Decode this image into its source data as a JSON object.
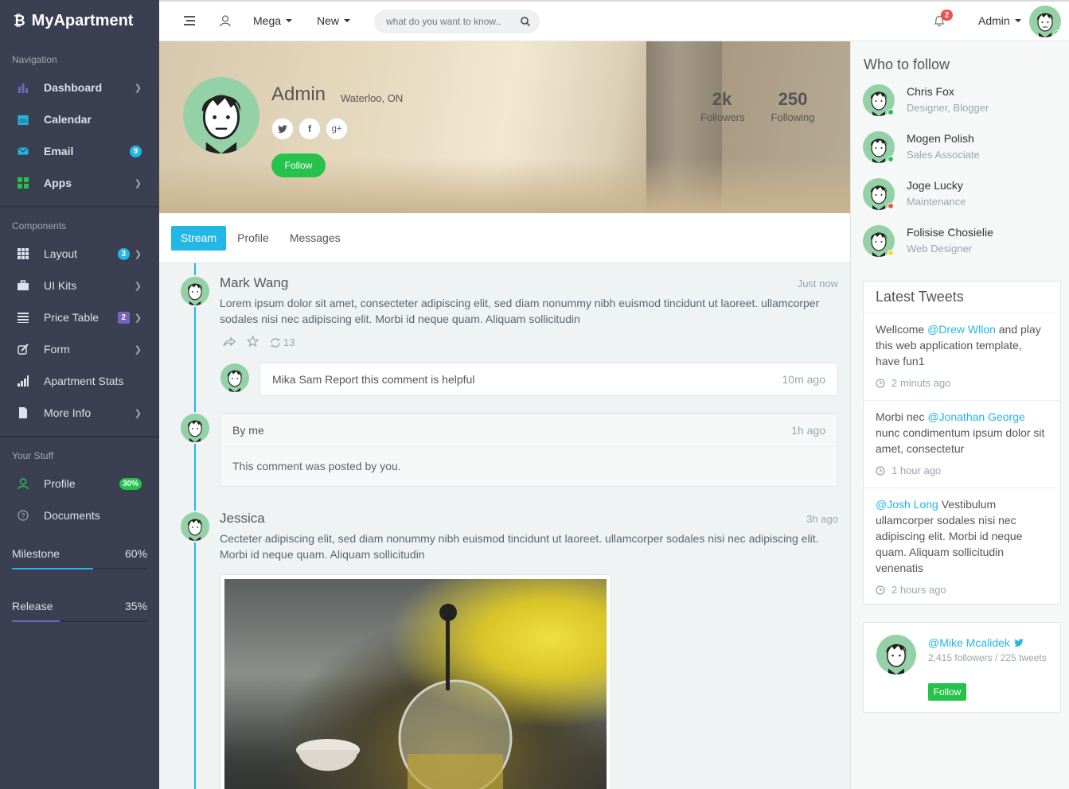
{
  "brand": {
    "name": "MyApartment"
  },
  "sidebar": {
    "sections": [
      "Navigation",
      "Components",
      "Your Stuff"
    ],
    "nav": [
      {
        "label": "Dashboard",
        "icon": "bar-chart-icon",
        "badge": ""
      },
      {
        "label": "Calendar",
        "icon": "calendar-icon",
        "badge": ""
      },
      {
        "label": "Email",
        "icon": "envelope-icon",
        "badge": "9"
      },
      {
        "label": "Apps",
        "icon": "grid-icon",
        "badge": ""
      }
    ],
    "components": [
      {
        "label": "Layout",
        "icon": "layout-icon",
        "badge": "3"
      },
      {
        "label": "UI Kits",
        "icon": "briefcase-icon",
        "badge": ""
      },
      {
        "label": "Price Table",
        "icon": "list-icon",
        "badge": "2"
      },
      {
        "label": "Form",
        "icon": "edit-icon",
        "badge": ""
      },
      {
        "label": "Apartment Stats",
        "icon": "signal-icon",
        "badge": ""
      },
      {
        "label": "More Info",
        "icon": "file-icon",
        "badge": ""
      }
    ],
    "stuff": [
      {
        "label": "Profile",
        "icon": "user-icon",
        "badge": "30%"
      },
      {
        "label": "Documents",
        "icon": "question-icon",
        "badge": ""
      }
    ],
    "progress": [
      {
        "label": "Milestone",
        "value": "60%",
        "fraction": 0.6,
        "color": "#23b7e5"
      },
      {
        "label": "Release",
        "value": "35%",
        "fraction": 0.35,
        "color": "#7266ba"
      }
    ]
  },
  "topbar": {
    "mega": "Mega",
    "new": "New",
    "search_placeholder": "what do you want to know..",
    "notifications": "2",
    "user": "Admin"
  },
  "profile": {
    "name": "Admin",
    "location": "Waterloo, ON",
    "follow": "Follow",
    "followers": {
      "value": "2k",
      "label": "Followers"
    },
    "following": {
      "value": "250",
      "label": "Following"
    }
  },
  "tabs": [
    "Stream",
    "Profile",
    "Messages"
  ],
  "stream": {
    "post1": {
      "name": "Mark Wang",
      "time": "Just now",
      "body": "Lorem ipsum dolor sit amet, consecteter adipiscing elit, sed diam nonummy nibh euismod tincidunt ut laoreet. ullamcorper sodales nisi nec adipiscing elit. Morbi id neque quam. Aliquam sollicitudin",
      "retweets": "13"
    },
    "reply": {
      "user": "Mika Sam",
      "text": " Report this comment is helpful",
      "time": "10m ago"
    },
    "mine": {
      "header": "By me",
      "time": "1h ago",
      "text": "This comment was posted by you."
    },
    "post2": {
      "name": "Jessica",
      "time": "3h ago",
      "body": "Cecteter adipiscing elit, sed diam nonummy nibh euismod tincidunt ut laoreet. ullamcorper sodales nisi nec adipiscing elit. Morbi id neque quam. Aliquam sollicitudin"
    }
  },
  "right": {
    "who_title": "Who to follow",
    "people": [
      {
        "name": "Chris Fox",
        "role": "Designer, Blogger",
        "status": "#27c24c"
      },
      {
        "name": "Mogen Polish",
        "role": "Sales Associate",
        "status": "#27c24c"
      },
      {
        "name": "Joge Lucky",
        "role": "Maintenance",
        "status": "#f05050"
      },
      {
        "name": "Folisise Chosielie",
        "role": "Web Designer",
        "status": "#fad733"
      }
    ],
    "tweets_title": "Latest Tweets",
    "tweets": [
      {
        "pre": "Wellcome ",
        "link": "@Drew Wllon",
        "post": " and play this web application template, have fun1",
        "time": "2 minuts ago"
      },
      {
        "pre": "Morbi nec ",
        "link": "@Jonathan George",
        "post": " nunc condimentum ipsum dolor sit amet, consectetur",
        "time": "1 hour ago"
      },
      {
        "pre": "",
        "link": "@Josh Long",
        "post": " Vestibulum ullamcorper sodales nisi nec adipiscing elit. Morbi id neque quam. Aliquam sollicitudin venenatis",
        "time": "2 hours ago"
      }
    ],
    "mike": {
      "handle": "@Mike Mcalidek",
      "stats": "2,415 followers / 225 tweets",
      "follow": "Follow"
    }
  }
}
